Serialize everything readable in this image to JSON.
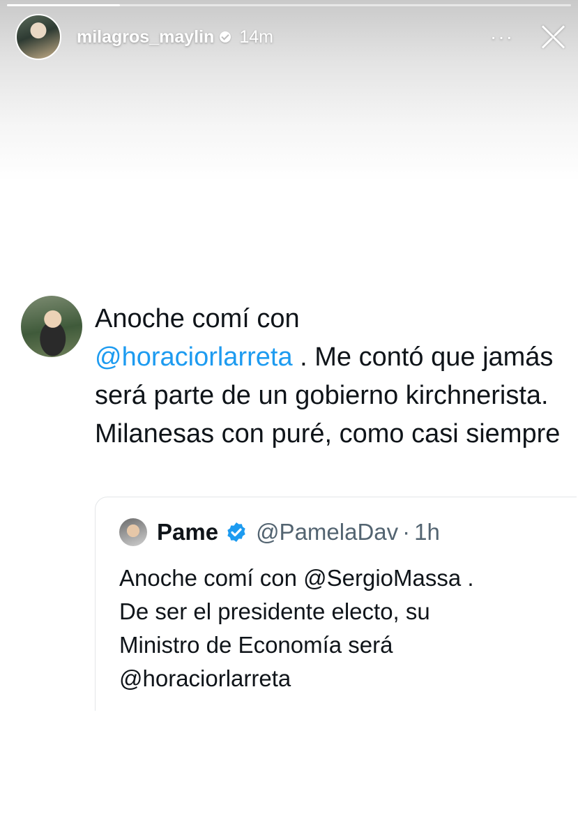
{
  "story": {
    "progress_fraction": 0.2,
    "username": "milagros_maylin",
    "timestamp": "14m",
    "more_label": "···"
  },
  "tweet": {
    "text_before_mention": "Anoche comí con",
    "mention": "@horaciorlarreta",
    "text_after_mention": " . Me contó que jamás será parte de un gobierno kirchnerista. Milanesas con puré, como casi siempre"
  },
  "quoted_tweet": {
    "name": "Pame",
    "handle": "@PamelaDav",
    "separator": "·",
    "time": "1h",
    "text_line1": "Anoche comí con @SergioMassa .",
    "text_line2": "De ser el presidente electo, su",
    "text_line3": "Ministro de Economía será",
    "text_line4": "@horaciorlarreta"
  },
  "colors": {
    "mention": "#1d9bf0",
    "verified": "#1d9bf0",
    "handle_gray": "#536471"
  },
  "icons": {
    "verified": "verified-icon",
    "more": "more-icon",
    "close": "close-icon"
  }
}
